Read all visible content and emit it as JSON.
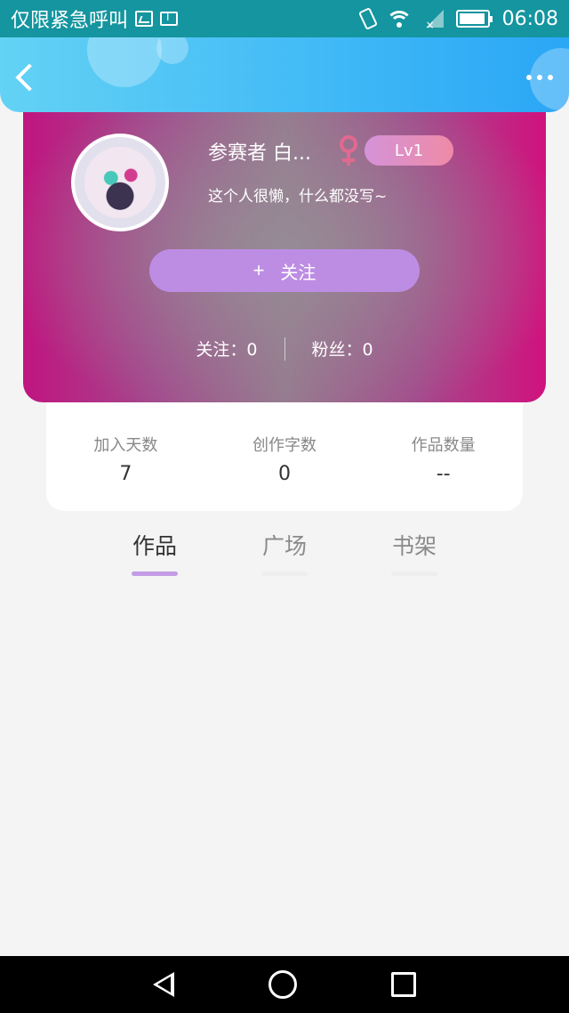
{
  "status_bar": {
    "carrier_text": "仅限紧急呼叫",
    "time": "06:08",
    "battery_level": 0.95
  },
  "header": {
    "back_icon": "chevron-left-icon",
    "more_icon": "more-horizontal-icon"
  },
  "profile": {
    "username": "参赛者 白...",
    "level": "Lv1",
    "bio": "这个人很懒，什么都没写~",
    "follow_label": "关注",
    "follow_plus": "+",
    "following_text": "关注：0",
    "fans_text": "粉丝：0",
    "gender_icon": "female-icon"
  },
  "info": [
    {
      "label": "加入天数",
      "value": "7"
    },
    {
      "label": "创作字数",
      "value": "0"
    },
    {
      "label": "作品数量",
      "value": "--"
    }
  ],
  "tabs": [
    {
      "label": "作品",
      "active": true
    },
    {
      "label": "广场",
      "active": false
    },
    {
      "label": "书架",
      "active": false
    }
  ],
  "colors": {
    "accent": "#c39ce6",
    "header": "#3fb8f6",
    "card_magenta": "#c0157f"
  }
}
